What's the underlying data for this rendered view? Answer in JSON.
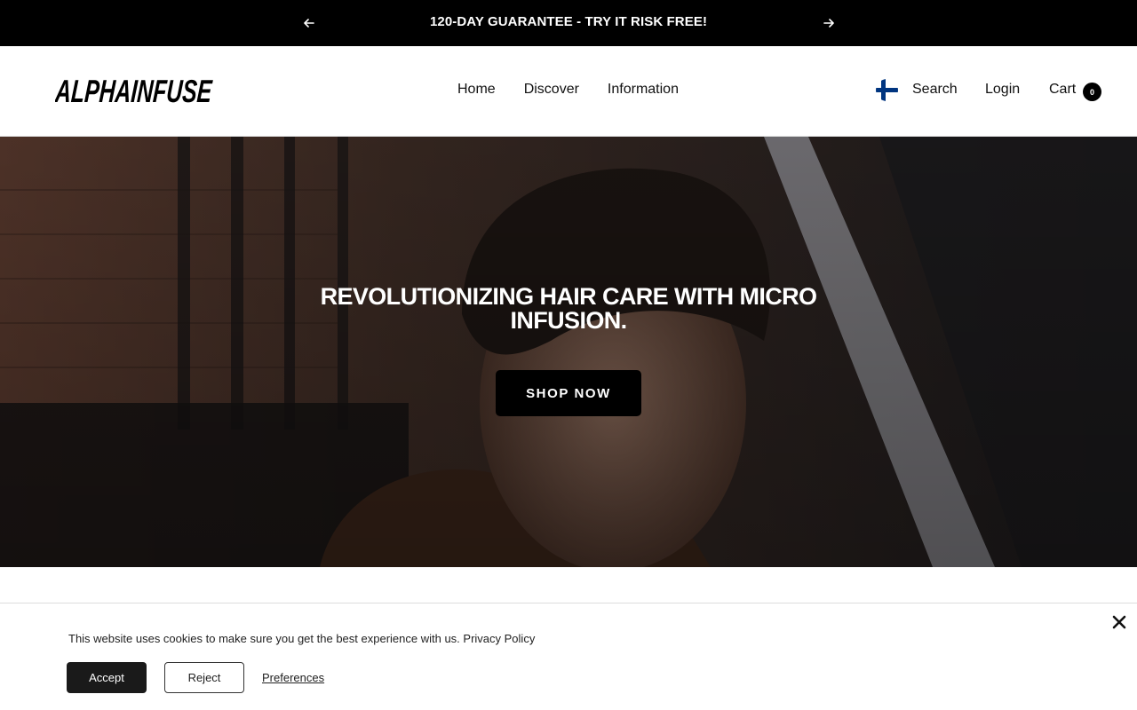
{
  "announcement": {
    "message": "120-DAY GUARANTEE - TRY IT RISK FREE!",
    "prev_icon": "arrow-left-icon",
    "next_icon": "arrow-right-icon"
  },
  "header": {
    "logo": "ALPHAINFUSE",
    "nav": [
      {
        "label": "Home"
      },
      {
        "label": "Discover"
      },
      {
        "label": "Information"
      }
    ],
    "flag_icon": "finland-flag-icon",
    "search_label": "Search",
    "login_label": "Login",
    "cart_label": "Cart",
    "cart_count": "0"
  },
  "hero": {
    "title": "REVOLUTIONIZING HAIR CARE WITH MICRO INFUSION.",
    "cta_label": "SHOP NOW"
  },
  "cookie": {
    "message": "This website uses cookies to make sure you get the best experience with us.",
    "policy_link": "Privacy Policy",
    "accept_label": "Accept",
    "reject_label": "Reject",
    "preferences_label": "Preferences",
    "close_icon": "close-icon"
  },
  "colors": {
    "announcement_bg": "#000000",
    "button_bg": "#000000",
    "flag_blue": "#003580"
  }
}
